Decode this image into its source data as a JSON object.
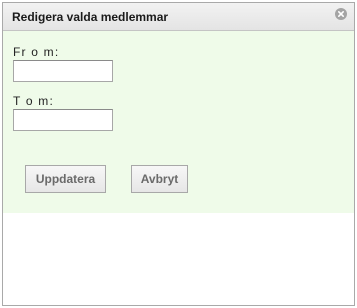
{
  "dialog": {
    "title": "Redigera valda medlemmar",
    "close_icon": "close-circle-icon"
  },
  "form": {
    "from_label": "Fr o m:",
    "from_value": "",
    "to_label": "T o m:",
    "to_value": ""
  },
  "buttons": {
    "update_label": "Uppdatera",
    "cancel_label": "Avbryt"
  },
  "colors": {
    "content_background": "#effbe9",
    "titlebar_background": "#e9e9e9",
    "border": "#a9a9a9",
    "button_text": "#6a6a6a"
  }
}
